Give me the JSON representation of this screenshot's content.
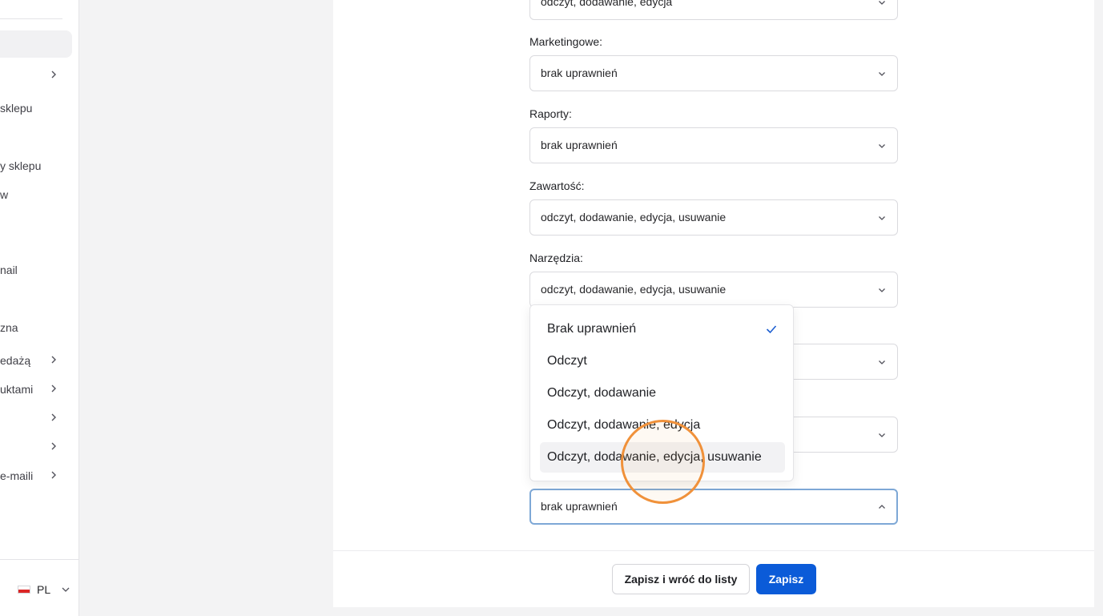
{
  "sidebar": {
    "items": [
      {
        "label": "sklepu",
        "chevron": false
      },
      {
        "label": "y sklepu",
        "chevron": false
      },
      {
        "label": "w",
        "chevron": false
      },
      {
        "label": "nail",
        "chevron": false
      },
      {
        "label": "zna",
        "chevron": false
      },
      {
        "label": "edażą",
        "chevron": true
      },
      {
        "label": "uktami",
        "chevron": true
      },
      {
        "label": "e-maili",
        "chevron": true
      }
    ],
    "language": "PL"
  },
  "form": {
    "top_value": "odczyt, dodawanie, edycja",
    "fields": [
      {
        "label": "Marketingowe:",
        "value": "brak uprawnień"
      },
      {
        "label": "Raporty:",
        "value": "brak uprawnień"
      },
      {
        "label": "Zawartość:",
        "value": "odczyt, dodawanie, edycja, usuwanie"
      },
      {
        "label": "Narzędzia:",
        "value": "odczyt, dodawanie, edycja, usuwanie"
      }
    ],
    "open_select_value": "brak uprawnień"
  },
  "dropdown": {
    "options": [
      "Brak uprawnień",
      "Odczyt",
      "Odczyt, dodawanie",
      "Odczyt, dodawanie, edycja",
      "Odczyt, dodawanie, edycja, usuwanie"
    ],
    "selected_index": 0,
    "hovered_index": 4,
    "check_color": "#1d5fd1"
  },
  "footer": {
    "save_and_back_label": "Zapisz i wróć do listy",
    "save_label": "Zapisz"
  },
  "colors": {
    "primary": "#0b5bd8",
    "highlight": "#f0913a"
  }
}
